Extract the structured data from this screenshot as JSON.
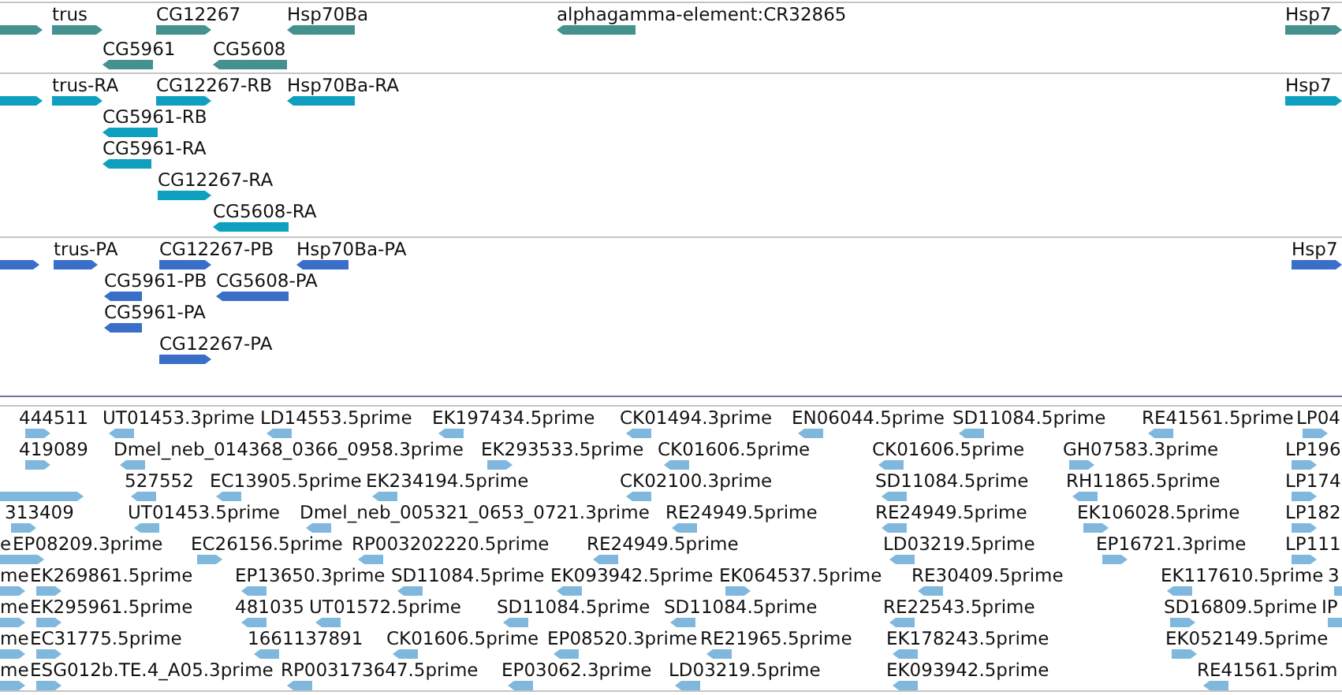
{
  "tracks": [
    {
      "kind": "gene",
      "color": "#44918f",
      "rows": [
        [
          {
            "reverse": false
          },
          {
            "label": "trus",
            "reverse": false
          },
          {
            "label": "CG12267",
            "reverse": false
          },
          {
            "label": "Hsp70Ba",
            "reverse": true
          },
          {
            "label": "alphagamma-element:CR32865",
            "reverse": true
          },
          {
            "label": "Hsp7",
            "reverse": false
          }
        ],
        [
          {
            "label": "CG5961",
            "reverse": true
          },
          {
            "label": "CG5608",
            "reverse": true
          }
        ]
      ]
    },
    {
      "kind": "gene",
      "color": "#0fa0bf",
      "rows": [
        [
          {
            "reverse": false
          },
          {
            "label": "trus-RA",
            "reverse": false
          },
          {
            "label": "CG12267-RB",
            "reverse": false
          },
          {
            "label": "Hsp70Ba-RA",
            "reverse": true
          },
          {
            "label": "Hsp7",
            "reverse": false
          }
        ],
        [
          {
            "label": "CG5961-RB",
            "reverse": true
          }
        ],
        [
          {
            "label": "CG5961-RA",
            "reverse": true
          }
        ],
        [
          {
            "label": "CG12267-RA",
            "reverse": false
          }
        ],
        [
          {
            "label": "CG5608-RA",
            "reverse": true
          }
        ]
      ]
    },
    {
      "kind": "gene",
      "color": "#3a6fc9",
      "rows": [
        [
          {
            "reverse": false
          },
          {
            "label": "trus-PA",
            "reverse": false
          },
          {
            "label": "CG12267-PB",
            "reverse": false
          },
          {
            "label": "Hsp70Ba-PA",
            "reverse": true
          },
          {
            "label": "Hsp7",
            "reverse": false
          }
        ],
        [
          {
            "label": "CG5961-PB",
            "reverse": true
          },
          {
            "label": "CG5608-PA",
            "reverse": true
          }
        ],
        [
          {
            "label": "CG5961-PA",
            "reverse": true
          }
        ],
        [
          {
            "label": "CG12267-PA",
            "reverse": false
          }
        ]
      ]
    },
    {
      "kind": "est",
      "color": "#7fb8dc",
      "rows": [
        [
          {
            "label": "444511",
            "reverse": false
          },
          {
            "label": "UT01453.3prime",
            "reverse": true
          },
          {
            "label": "LD14553.5prime",
            "reverse": true
          },
          {
            "label": "EK197434.5prime",
            "reverse": true
          },
          {
            "label": "CK01494.3prime",
            "reverse": true
          },
          {
            "label": "EN06044.5prime",
            "reverse": true
          },
          {
            "label": "SD11084.5prime",
            "reverse": true
          },
          {
            "label": "RE41561.5prime",
            "reverse": true
          },
          {
            "label": "LP04",
            "reverse": false
          }
        ],
        [
          {
            "label": "419089",
            "reverse": false
          },
          {
            "label": "Dmel_neb_014368_0366_0958.3prime",
            "reverse": true
          },
          {
            "label": "EK293533.5prime",
            "reverse": false
          },
          {
            "label": "CK01606.5prime",
            "reverse": true
          },
          {
            "label": "CK01606.5prime",
            "reverse": true
          },
          {
            "label": "GH07583.3prime",
            "reverse": false
          },
          {
            "label": "LP196",
            "reverse": false
          }
        ],
        [
          {
            "reverse": false
          },
          {
            "label": "527552",
            "reverse": true
          },
          {
            "label": "EC13905.5prime",
            "reverse": true
          },
          {
            "label": "EK234194.5prime",
            "reverse": true
          },
          {
            "label": "CK02100.3prime",
            "reverse": true
          },
          {
            "label": "SD11084.5prime",
            "reverse": true
          },
          {
            "label": "RH11865.5prime",
            "reverse": true
          },
          {
            "label": "LP174",
            "reverse": false
          }
        ],
        [
          {
            "label": "313409",
            "reverse": false
          },
          {
            "label": "UT01453.5prime",
            "reverse": true
          },
          {
            "label": "Dmel_neb_005321_0653_0721.3prime",
            "reverse": true
          },
          {
            "label": "RE24949.5prime",
            "reverse": true
          },
          {
            "label": "RE24949.5prime",
            "reverse": true
          },
          {
            "label": "EK106028.5prime",
            "reverse": false
          },
          {
            "label": "LP182",
            "reverse": false
          }
        ],
        [
          {
            "label": "e",
            "reverse": false
          },
          {
            "label": "EP08209.3prime",
            "reverse": false
          },
          {
            "label": "EC26156.5prime",
            "reverse": false
          },
          {
            "label": "RP003202220.5prime",
            "reverse": true
          },
          {
            "label": "RE24949.5prime",
            "reverse": true
          },
          {
            "label": "LD03219.5prime",
            "reverse": true
          },
          {
            "label": "EP16721.3prime",
            "reverse": false
          },
          {
            "label": "LP111",
            "reverse": false
          }
        ],
        [
          {
            "label": "me",
            "reverse": false
          },
          {
            "label": "EK269861.5prime",
            "reverse": false
          },
          {
            "label": "EP13650.3prime",
            "reverse": true
          },
          {
            "label": "SD11084.5prime",
            "reverse": true
          },
          {
            "label": "EK093942.5prime",
            "reverse": true
          },
          {
            "label": "EK064537.5prime",
            "reverse": false
          },
          {
            "label": "RE30409.5prime",
            "reverse": true
          },
          {
            "label": "EK117610.5prime",
            "reverse": true
          },
          {
            "label": "3",
            "reverse": false
          }
        ],
        [
          {
            "label": "me",
            "reverse": false
          },
          {
            "label": "EK295961.5prime",
            "reverse": false
          },
          {
            "label": "481035",
            "reverse": true
          },
          {
            "label": "UT01572.5prime",
            "reverse": true
          },
          {
            "label": "SD11084.5prime",
            "reverse": true
          },
          {
            "label": "SD11084.5prime",
            "reverse": true
          },
          {
            "label": "RE22543.5prime",
            "reverse": true
          },
          {
            "label": "SD16809.5prime",
            "reverse": false
          },
          {
            "label": "IP",
            "reverse": false
          }
        ],
        [
          {
            "label": "me",
            "reverse": false
          },
          {
            "label": "EC31775.5prime",
            "reverse": false
          },
          {
            "label": "1661137891",
            "reverse": true
          },
          {
            "label": "CK01606.5prime",
            "reverse": true
          },
          {
            "label": "EP08520.3prime",
            "reverse": true
          },
          {
            "label": "RE21965.5prime",
            "reverse": true
          },
          {
            "label": "EK178243.5prime",
            "reverse": true
          },
          {
            "label": "EK052149.5prime",
            "reverse": false
          }
        ],
        [
          {
            "label": "me",
            "reverse": false
          },
          {
            "label": "ESG012b.TE.4_A05.3prime",
            "reverse": false
          },
          {
            "label": "RP003173647.5prime",
            "reverse": true
          },
          {
            "label": "EP03062.3prime",
            "reverse": true
          },
          {
            "label": "LD03219.5prime",
            "reverse": true
          },
          {
            "label": "EK093942.5prime",
            "reverse": true
          },
          {
            "label": "RE41561.5prim",
            "reverse": true
          }
        ]
      ]
    }
  ]
}
